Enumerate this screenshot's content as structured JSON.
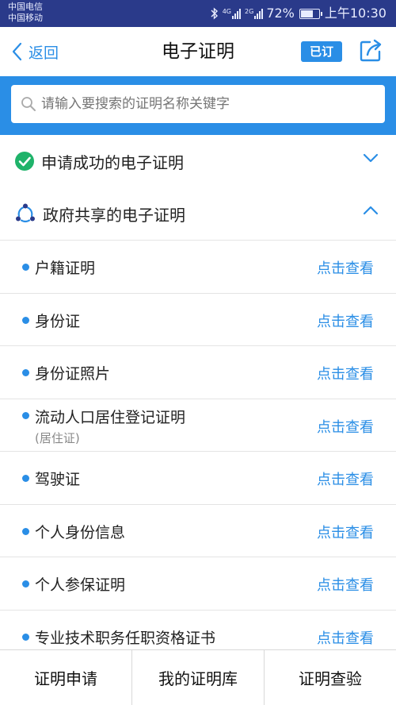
{
  "status_bar": {
    "carrier_1": "中国电信",
    "carrier_2": "中国移动",
    "net_1": "4G",
    "net_2": "2G",
    "battery": "72%",
    "battery_level": 0.72,
    "time": "上午10:30"
  },
  "nav": {
    "back_label": "返回",
    "title": "电子证明",
    "subscribed_badge": "已订",
    "share_icon": "share-icon"
  },
  "search": {
    "placeholder": "请输入要搜索的证明名称关键字"
  },
  "sections": [
    {
      "label": "申请成功的电子证明",
      "icon": "check-circle-icon",
      "expanded": false
    },
    {
      "label": "政府共享的电子证明",
      "icon": "share-network-icon",
      "expanded": true
    }
  ],
  "items": [
    {
      "name": "户籍证明",
      "action": "点击查看"
    },
    {
      "name": "身份证",
      "action": "点击查看"
    },
    {
      "name": "身份证照片",
      "action": "点击查看"
    },
    {
      "name": "流动人口居住登记证明",
      "sub": "(居住证)",
      "action": "点击查看"
    },
    {
      "name": "驾驶证",
      "action": "点击查看"
    },
    {
      "name": "个人身份信息",
      "action": "点击查看"
    },
    {
      "name": "个人参保证明",
      "action": "点击查看"
    },
    {
      "name": "专业技术职务任职资格证书",
      "action": "点击查看"
    }
  ],
  "tabs": [
    {
      "label": "证明申请"
    },
    {
      "label": "我的证明库"
    },
    {
      "label": "证明查验"
    }
  ],
  "colors": {
    "accent": "#2a8ee6",
    "status_bar": "#2a3a8a",
    "success": "#1fb36a"
  }
}
